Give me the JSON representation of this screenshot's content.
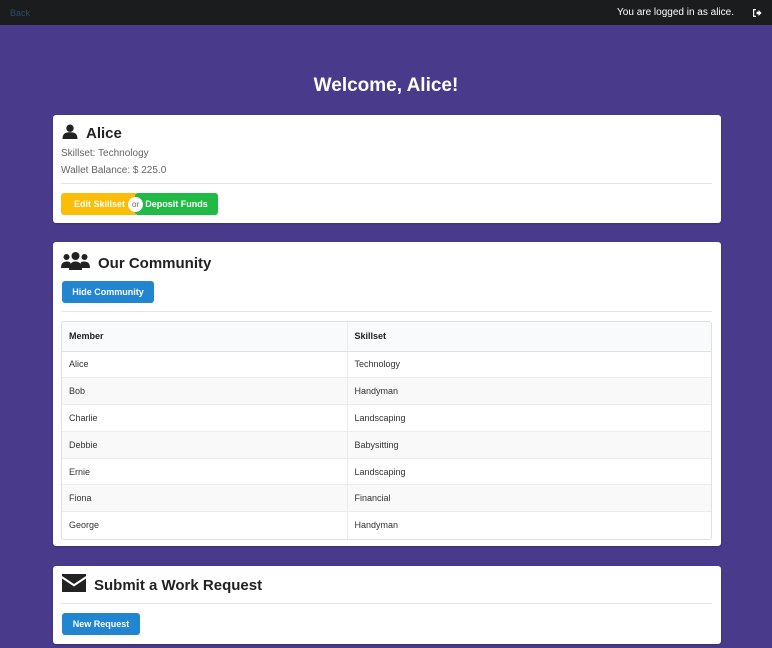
{
  "topbar": {
    "brand": "Back",
    "logged_in_text": "You are logged in as alice."
  },
  "welcome": "Welcome, Alice!",
  "profile": {
    "name": "Alice",
    "skillset": "Skillset: Technology",
    "wallet": "Wallet Balance: $ 225.0",
    "edit_label": "Edit Skillset",
    "or_label": "or",
    "deposit_label": "Deposit Funds"
  },
  "community": {
    "title": "Our Community",
    "toggle_label": "Hide Community",
    "columns": [
      "Member",
      "Skillset"
    ],
    "rows": [
      {
        "member": "Alice",
        "skillset": "Technology"
      },
      {
        "member": "Bob",
        "skillset": "Handyman"
      },
      {
        "member": "Charlie",
        "skillset": "Landscaping"
      },
      {
        "member": "Debbie",
        "skillset": "Babysitting"
      },
      {
        "member": "Ernie",
        "skillset": "Landscaping"
      },
      {
        "member": "Fiona",
        "skillset": "Financial"
      },
      {
        "member": "George",
        "skillset": "Handyman"
      }
    ]
  },
  "work_request": {
    "title": "Submit a Work Request",
    "new_label": "New Request"
  },
  "colors": {
    "background": "#4a3a8c",
    "yellow": "#fbbd08",
    "green": "#21ba45",
    "blue": "#2185d0"
  },
  "icons": [
    "user-icon",
    "users-icon",
    "envelope-icon",
    "logout-icon"
  ]
}
